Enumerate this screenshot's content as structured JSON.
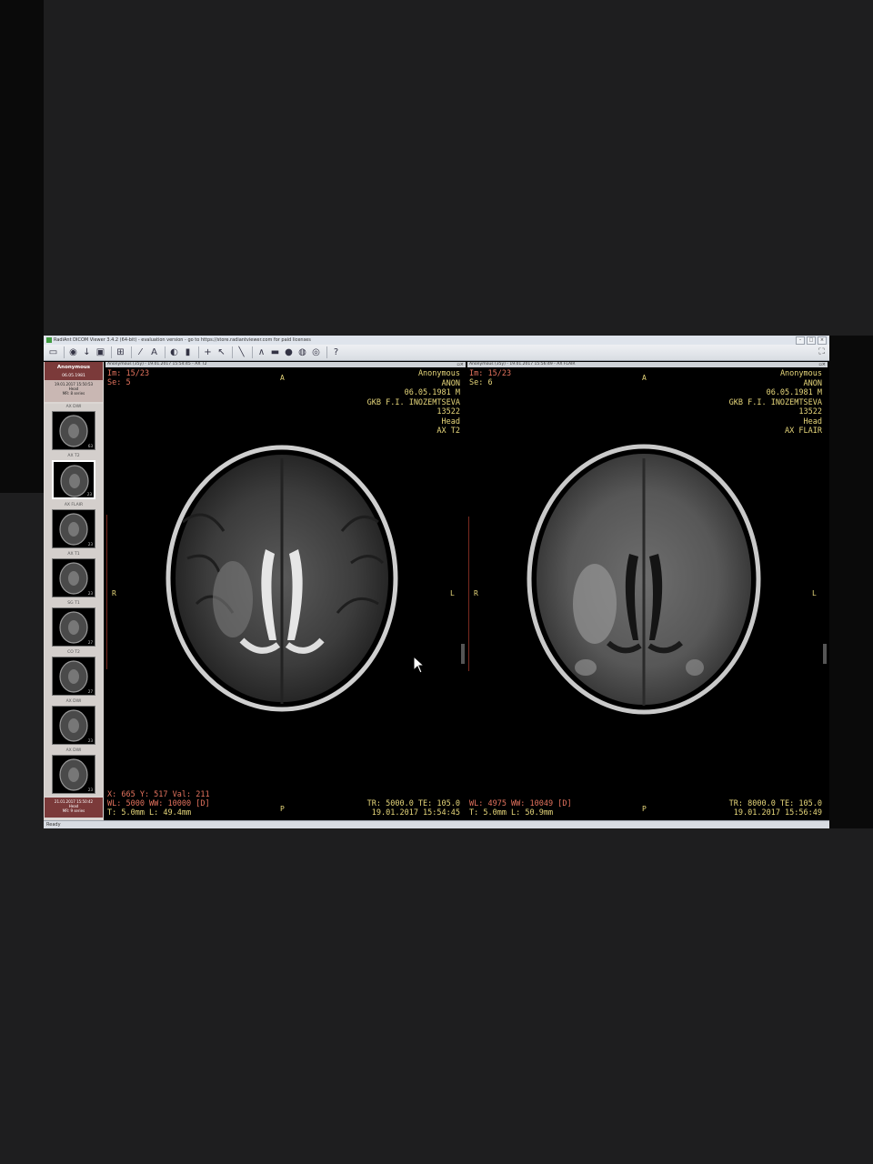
{
  "window": {
    "title": "RadiAnt DICOM Viewer 3.4.2 (64-bit) - evaluation version - go to https://store.radiantviewer.com for paid licenses"
  },
  "toolbar": {
    "icons": [
      "open-folder-icon",
      "cd-icon",
      "download-icon",
      "save-icon",
      "layout-icon",
      "wand-icon",
      "text-icon",
      "wl-icon",
      "crosshair-icon",
      "cursor-icon",
      "measure-icon",
      "angle-icon",
      "camera-icon",
      "record-icon",
      "3d-icon",
      "mpr-icon",
      "help-icon"
    ]
  },
  "sidebar": {
    "patient_name": "Anonymous",
    "patient_dob": "06.05.1981",
    "study_date": "19.01.2017 15:50:53",
    "study_body": "Head",
    "study_series": "MR: 8 series",
    "series": [
      {
        "label": "AX DWI",
        "count": "63",
        "active": false
      },
      {
        "label": "AX T2",
        "count": "23",
        "active": true
      },
      {
        "label": "AX FLAIR",
        "count": "23",
        "active": false
      },
      {
        "label": "AX T1",
        "count": "23",
        "active": false
      },
      {
        "label": "SG T1",
        "count": "27",
        "active": false
      },
      {
        "label": "CO T2",
        "count": "27",
        "active": false
      },
      {
        "label": "AX DWI",
        "count": "23",
        "active": false
      },
      {
        "label": "AX DWI",
        "count": "23",
        "active": false
      }
    ],
    "study2_date": "21.01.2017 15:50:42",
    "study2_body": "Head",
    "study2_series": "MR: 9 series"
  },
  "viewports": [
    {
      "header": "Anonymous (35y) - 19.01.2017 15:54:45 - AX T2",
      "image": "Im: 15/23",
      "series": "Se: 5",
      "patient": "Anonymous",
      "patient_id": "ANON",
      "dob_sex": "06.05.1981 M",
      "institution": "GKB F.I. INOZEMTSEVA",
      "study_id": "13522",
      "body_part": "Head",
      "description": "AX T2",
      "cursor_readout": "X: 665 Y: 517 Val: 211",
      "window_level": "WL: 5000 WW: 10000 [D]",
      "thickness": "T: 5.0mm L: 49.4mm",
      "tr_te": "TR: 5000.0 TE: 105.0",
      "datetime": "19.01.2017 15:54:45",
      "orient_top": "A",
      "orient_bottom": "P",
      "orient_left": "R",
      "orient_right": "L"
    },
    {
      "header": "Anonymous (35y) - 19.01.2017 15:56:49 - AX FLAIR",
      "image": "Im: 15/23",
      "series": "Se: 6",
      "patient": "Anonymous",
      "patient_id": "ANON",
      "dob_sex": "06.05.1981 M",
      "institution": "GKB F.I. INOZEMTSEVA",
      "study_id": "13522",
      "body_part": "Head",
      "description": "AX FLAIR",
      "window_level": "WL: 4975 WW: 10049 [D]",
      "thickness": "T: 5.0mm L: 50.9mm",
      "tr_te": "TR: 8000.0 TE: 105.0",
      "datetime": "19.01.2017 15:56:49",
      "orient_top": "A",
      "orient_bottom": "P",
      "orient_left": "R",
      "orient_right": "L"
    }
  ],
  "statusbar": {
    "text": "Ready"
  }
}
